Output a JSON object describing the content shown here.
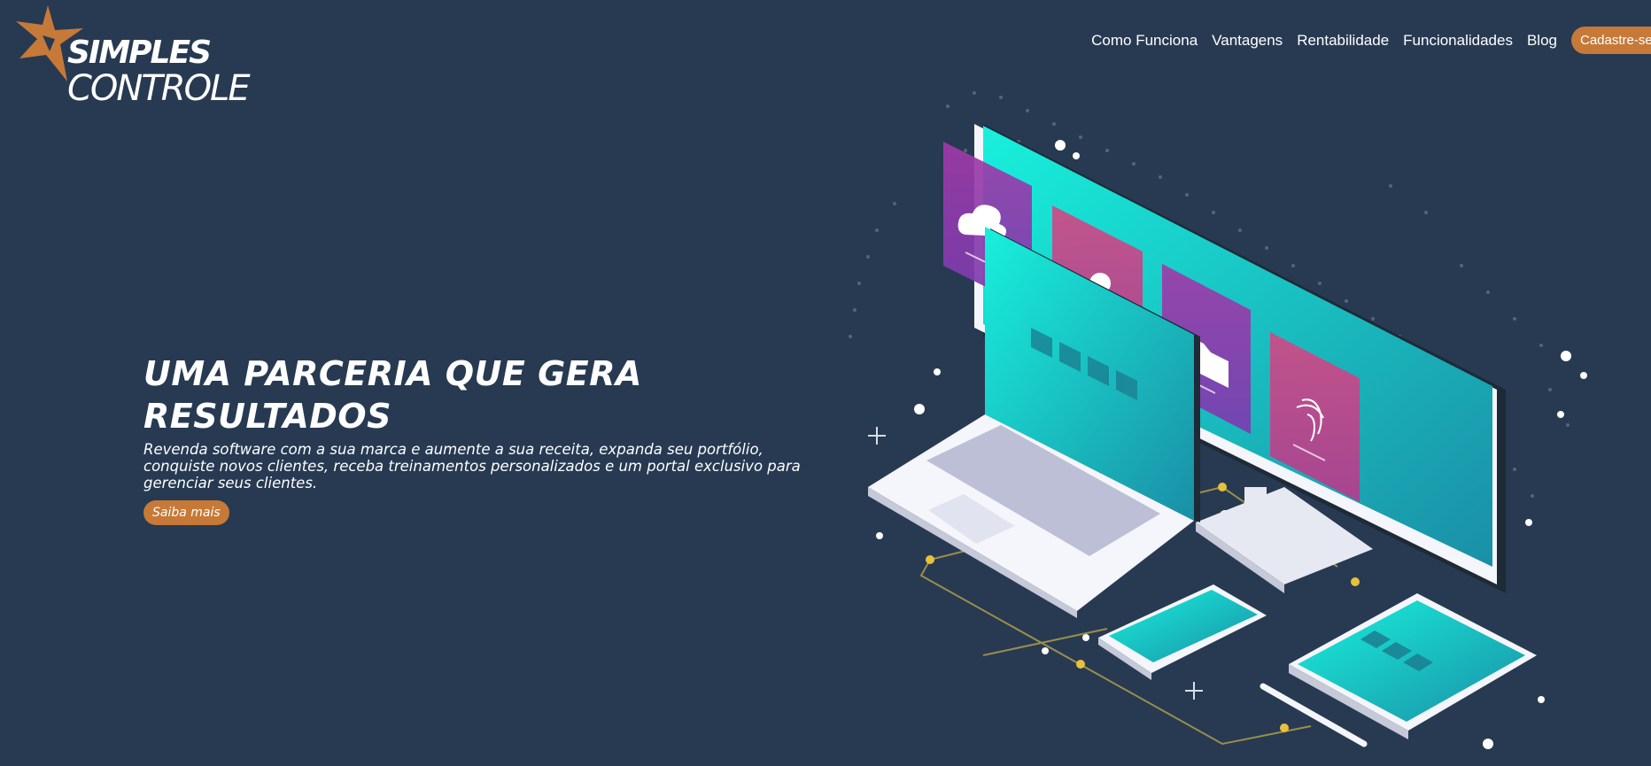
{
  "brand": {
    "line1": "SIMPLES",
    "line2": "CONTROLE",
    "accent": "#c77938"
  },
  "nav": {
    "items": [
      "Como Funciona",
      "Vantagens",
      "Rentabilidade",
      "Funcionalidades",
      "Blog"
    ],
    "cta": "Cadastre-se"
  },
  "hero": {
    "title_line1": "UMA PARCERIA QUE GERA",
    "title_line2": "RESULTADOS",
    "description": "Revenda software com a sua marca e aumente a sua receita, expanda seu portfólio, conquiste novos clientes, receba treinamentos personalizados e um portal exclusivo para gerenciar seus clientes.",
    "button": "Saiba mais"
  },
  "illustration": {
    "icons": [
      "cloud-icon",
      "user-icon",
      "folder-icon",
      "fingerprint-icon"
    ]
  },
  "colors": {
    "background": "#273a52",
    "accent": "#c77938",
    "teal": "#19d4c9",
    "pink": "#d04a86",
    "purple": "#8f3db0"
  }
}
